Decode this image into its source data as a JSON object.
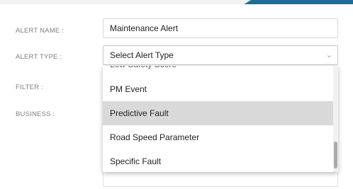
{
  "form": {
    "alert_name_label": "ALERT NAME :",
    "alert_name_value": "Maintenance Alert",
    "alert_type_label": "ALERT TYPE :",
    "alert_type_value": "Select Alert Type",
    "filter_label": "FILTER :",
    "business_label": "BUSINESS :"
  },
  "dropdown": {
    "partial_option": "Low Safety Score",
    "options": [
      "PM Event",
      "Predictive Fault",
      "Road Speed Parameter",
      "Specific Fault"
    ],
    "highlighted_option": "Predictive Fault"
  },
  "icons": {
    "select_chevron": "chevron-down-icon"
  },
  "colors": {
    "accent": "#1f6d93",
    "highlight": "#d9d9d9"
  }
}
